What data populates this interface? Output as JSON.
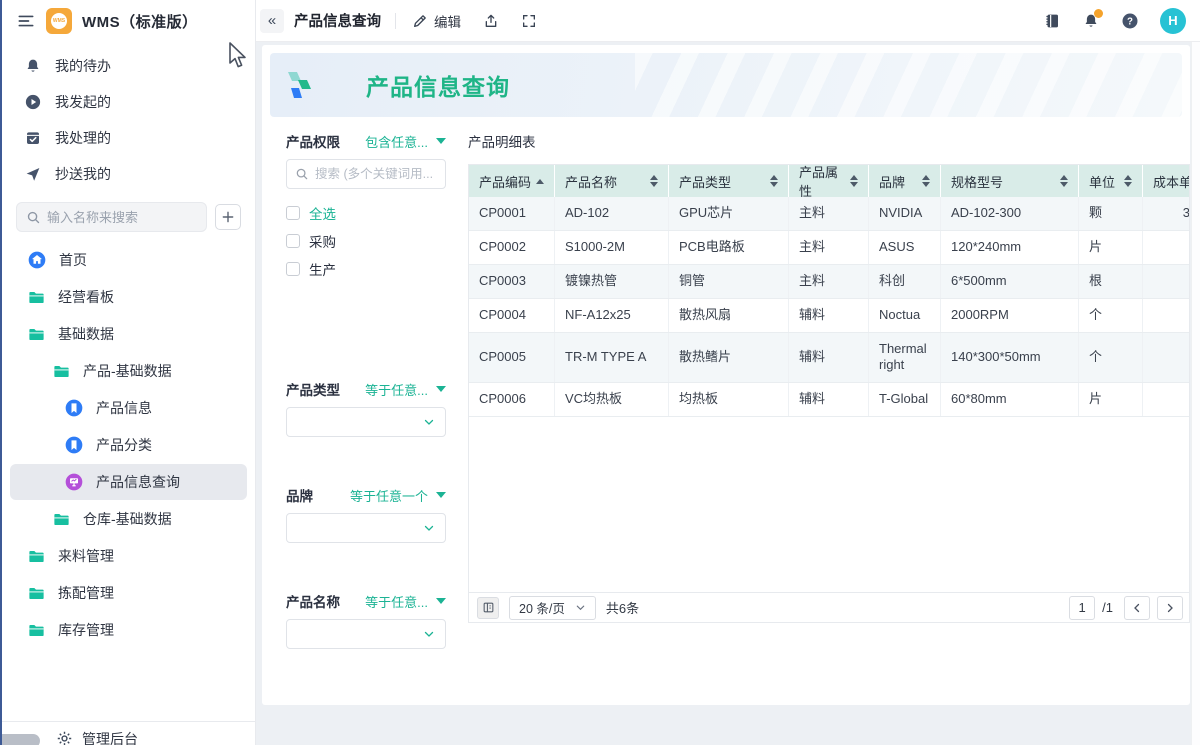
{
  "app": {
    "brand": "WMS（标准版）"
  },
  "topbar": {
    "collapse_glyph": "«",
    "page_title": "产品信息查询",
    "edit_label": "编辑",
    "avatar_text": "H"
  },
  "sidebar": {
    "workflow_items": [
      {
        "label": "我的待办",
        "icon": "bell"
      },
      {
        "label": "我发起的",
        "icon": "play-circle"
      },
      {
        "label": "我处理的",
        "icon": "task-check"
      },
      {
        "label": "抄送我的",
        "icon": "send"
      }
    ],
    "search_placeholder": "输入名称来搜索",
    "nav_items": [
      {
        "label": "首页",
        "icon": "home-circle",
        "depth": 0,
        "active": false
      },
      {
        "label": "经营看板",
        "icon": "folder",
        "depth": 0,
        "active": false
      },
      {
        "label": "基础数据",
        "icon": "folder",
        "depth": 0,
        "active": false
      },
      {
        "label": "产品-基础数据",
        "icon": "folder",
        "depth": 1,
        "active": false
      },
      {
        "label": "产品信息",
        "icon": "bookmark-circle",
        "depth": 2,
        "active": false
      },
      {
        "label": "产品分类",
        "icon": "bookmark-circle",
        "depth": 2,
        "active": false
      },
      {
        "label": "产品信息查询",
        "icon": "screen-circle",
        "depth": 2,
        "active": true
      },
      {
        "label": "仓库-基础数据",
        "icon": "folder",
        "depth": 1,
        "active": false
      },
      {
        "label": "来料管理",
        "icon": "folder",
        "depth": 0,
        "active": false
      },
      {
        "label": "拣配管理",
        "icon": "folder",
        "depth": 0,
        "active": false
      },
      {
        "label": "库存管理",
        "icon": "folder",
        "depth": 0,
        "active": false
      }
    ],
    "footer_label": "管理后台"
  },
  "banner": {
    "title": "产品信息查询"
  },
  "filters": {
    "sections": [
      {
        "label": "产品权限",
        "operator": "包含任意...",
        "type": "checkbox",
        "search_placeholder": "搜索 (多个关键词用...",
        "options": [
          {
            "label": "全选",
            "accent": true,
            "checked": false
          },
          {
            "label": "采购",
            "accent": false,
            "checked": false
          },
          {
            "label": "生产",
            "accent": false,
            "checked": false
          }
        ]
      },
      {
        "label": "产品类型",
        "operator": "等于任意...",
        "type": "select",
        "value": ""
      },
      {
        "label": "品牌",
        "operator": "等于任意一个",
        "type": "select",
        "value": ""
      },
      {
        "label": "产品名称",
        "operator": "等于任意...",
        "type": "select",
        "value": ""
      }
    ]
  },
  "table": {
    "title": "产品明细表",
    "columns": [
      {
        "label": "产品编码",
        "sort": "asc"
      },
      {
        "label": "产品名称",
        "sort": "both"
      },
      {
        "label": "产品类型",
        "sort": "both"
      },
      {
        "label": "产品属性",
        "sort": "both"
      },
      {
        "label": "品牌",
        "sort": "both"
      },
      {
        "label": "规格型号",
        "sort": "both"
      },
      {
        "label": "单位",
        "sort": "both"
      },
      {
        "label": "成本单价",
        "sort": "none"
      }
    ],
    "rows": [
      [
        "CP0001",
        "AD-102",
        "GPU芯片",
        "主料",
        "NVIDIA",
        "AD-102-300",
        "颗",
        "3"
      ],
      [
        "CP0002",
        "S1000-2M",
        "PCB电路板",
        "主料",
        "ASUS",
        "120*240mm",
        "片",
        ""
      ],
      [
        "CP0003",
        "镀镍热管",
        "铜管",
        "主料",
        "科创",
        "6*500mm",
        "根",
        ""
      ],
      [
        "CP0004",
        "NF-A12x25",
        "散热风扇",
        "辅料",
        "Noctua",
        "2000RPM",
        "个",
        ""
      ],
      [
        "CP0005",
        "TR-M TYPE A",
        "散热鳍片",
        "辅料",
        "Thermalright",
        "140*300*50mm",
        "个",
        ""
      ],
      [
        "CP0006",
        "VC均热板",
        "均热板",
        "辅料",
        "T-Global",
        "60*80mm",
        "片",
        ""
      ]
    ],
    "pagination": {
      "page_size": "20 条/页",
      "total": "共6条",
      "page": "1",
      "of": "/1"
    }
  },
  "colors": {
    "accent_teal": "#1bb394",
    "banner_title_green": "#1fb587",
    "folder_green": "#17bfa0",
    "node_blue": "#2e7cf6",
    "node_purple": "#b44fd9",
    "header_mint": "#d9ece8",
    "row_alt": "#f3f7f9",
    "avatar_cyan": "#27c2d4",
    "notification_orange": "#f5a32b",
    "app_icon_orange": "#f5a83a"
  }
}
